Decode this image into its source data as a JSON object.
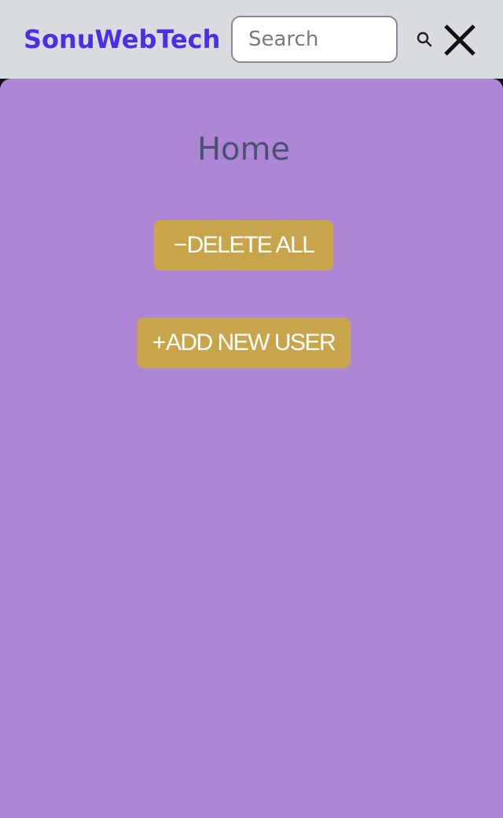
{
  "header": {
    "brand": "SonuWebTech",
    "search_placeholder": "Search",
    "search_icon": "search-icon",
    "close_icon": "close-icon"
  },
  "main": {
    "title": "Home",
    "delete_all_sign": "−",
    "delete_all_label": "DELETE ALL",
    "add_user_sign": "+",
    "add_user_label": "ADD NEW USER"
  },
  "colors": {
    "brand": "#4b2ee6",
    "header_bg": "#d8dbdf",
    "panel_bg": "#ad86d6",
    "button_bg": "#c8a54a",
    "title_text": "#4a5170"
  }
}
